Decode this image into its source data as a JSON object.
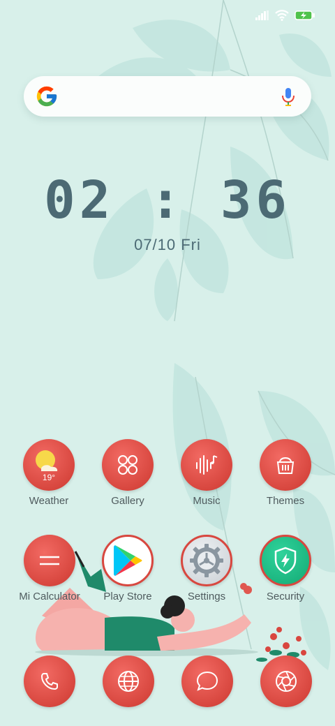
{
  "colors": {
    "background": "#d8f0ea",
    "leaf": "#bfe3dc",
    "clock_text": "#4c6a74",
    "app_icon": "#d8473f",
    "label_text": "#4f5b5e"
  },
  "status_bar": {
    "icons": [
      "signal-icon",
      "wifi-icon",
      "battery-charging-icon"
    ]
  },
  "search": {
    "logo": "google-g-icon",
    "voice": "microphone-icon"
  },
  "clock": {
    "time": "02 : 36",
    "date": "07/10 Fri"
  },
  "apps": [
    {
      "label": "Weather",
      "icon": "sun-cloud-icon",
      "temp": "19°"
    },
    {
      "label": "Gallery",
      "icon": "gallery-grid-icon"
    },
    {
      "label": "Music",
      "icon": "sound-wave-icon"
    },
    {
      "label": "Themes",
      "icon": "paint-bucket-icon"
    },
    {
      "label": "Mi Calculator",
      "icon": "equals-icon"
    },
    {
      "label": "Play Store",
      "icon": "play-store-icon"
    },
    {
      "label": "Settings",
      "icon": "gear-icon"
    },
    {
      "label": "Security",
      "icon": "shield-bolt-icon"
    }
  ],
  "dock": [
    {
      "icon": "phone-icon"
    },
    {
      "icon": "browser-globe-icon"
    },
    {
      "icon": "message-bubble-icon"
    },
    {
      "icon": "camera-aperture-icon"
    }
  ]
}
